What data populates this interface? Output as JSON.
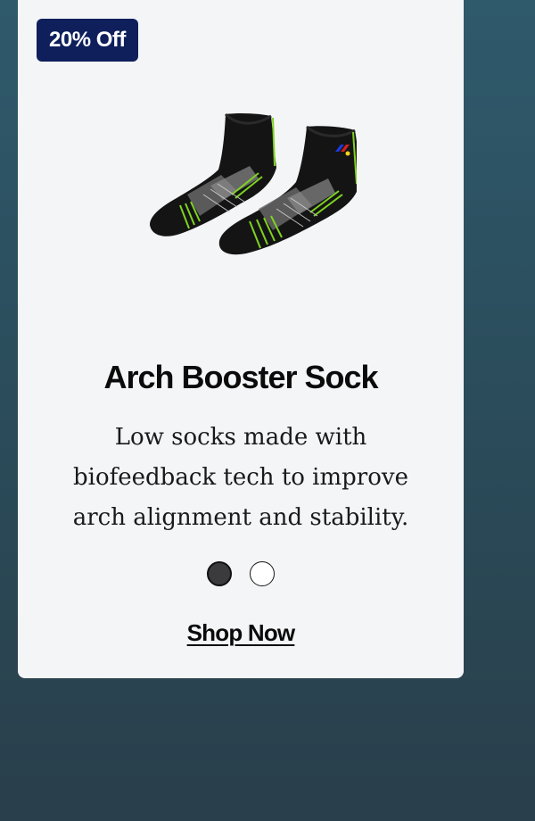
{
  "card": {
    "badge": "20% Off",
    "image_icon": "ankle-sock-pair-image",
    "title": "Arch Booster Sock",
    "description": "Low socks made with biofeedback tech to improve arch alignment and stability.",
    "color_options": [
      {
        "name": "black",
        "hex": "#3b3b3d",
        "selected": true
      },
      {
        "name": "white",
        "hex": "#ffffff",
        "selected": false
      }
    ],
    "cta_label": "Shop Now"
  },
  "colors": {
    "badge_bg": "#0e1f5b",
    "accent_green": "#7ed321",
    "card_bg": "#f4f5f7"
  }
}
